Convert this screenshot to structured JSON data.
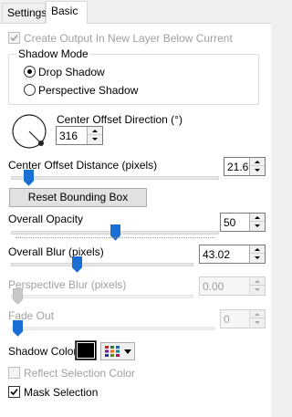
{
  "tabs": [
    {
      "label": "Settings",
      "active": false
    },
    {
      "label": "Basic",
      "active": true
    }
  ],
  "create_output": {
    "label": "Create Output In New Layer Below Current",
    "checked": true,
    "enabled": false
  },
  "shadow_mode": {
    "title": "Shadow Mode",
    "options": [
      {
        "label": "Drop Shadow",
        "selected": true
      },
      {
        "label": "Perspective Shadow",
        "selected": false
      }
    ]
  },
  "center_offset_direction": {
    "label": "Center Offset Direction (°)",
    "value": "316",
    "dial_angle_deg": 316
  },
  "center_offset_distance": {
    "label": "Center Offset Distance (pixels)",
    "value": "21.62",
    "slider_fraction": 0.08
  },
  "reset_button": {
    "label": "Reset Bounding Box"
  },
  "overall_opacity": {
    "label": "Overall Opacity",
    "value": "50",
    "slider_fraction": 0.5
  },
  "overall_blur": {
    "label": "Overall Blur (pixels)",
    "value": "43.02",
    "slider_fraction": 0.33
  },
  "perspective_blur": {
    "label": "Perspective Blur (pixels)",
    "value": "0.00",
    "slider_fraction": 0.0,
    "enabled": false
  },
  "fade_out": {
    "label": "Fade Out",
    "value": "0",
    "slider_fraction": 0.0,
    "enabled": false
  },
  "shadow_color": {
    "label": "Shadow Color",
    "color": "#000000"
  },
  "reflect_selection_color": {
    "label": "Reflect Selection Color",
    "checked": false,
    "enabled": false
  },
  "mask_selection": {
    "label": "Mask Selection",
    "checked": true,
    "enabled": true
  },
  "colors": {
    "accent": "#1a6fd4",
    "disabled_text": "#a0a0a0"
  }
}
